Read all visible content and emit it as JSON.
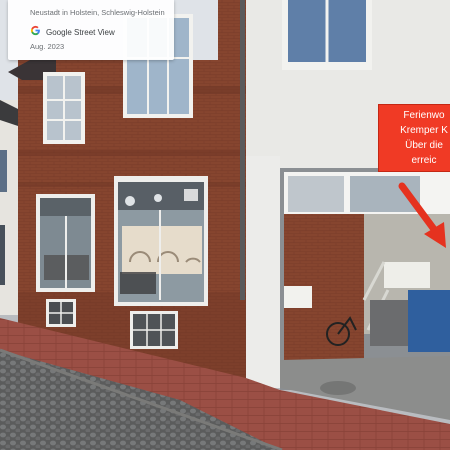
{
  "overlay": {
    "location": "Neustadt in Holstein, Schleswig-Holstein",
    "source": "Google Street View",
    "date": "Aug. 2023"
  },
  "sign": {
    "line1": "Ferienwo",
    "line2": "Kremper K",
    "line3": "Über die",
    "line4": "erreic"
  },
  "colors": {
    "brick": "#8a4a34",
    "white_building": "#e9e9e6",
    "sign_red": "#f03a25",
    "arrow_red": "#e5321f"
  },
  "icons": [
    "google-g-icon"
  ]
}
